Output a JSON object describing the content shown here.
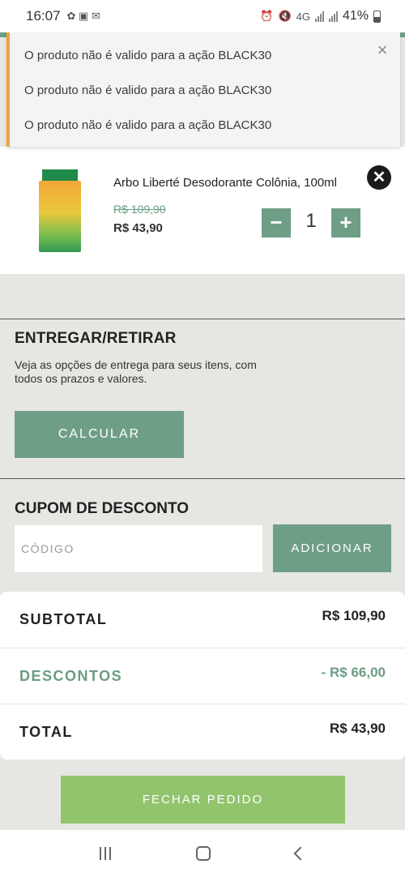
{
  "status_bar": {
    "time": "16:07",
    "network": "4G",
    "battery": "41%"
  },
  "toast": {
    "messages": [
      "O produto não é valido para a ação BLACK30",
      "O produto não é valido para a ação BLACK30",
      "O produto não é valido para a ação BLACK30"
    ],
    "close_icon": "×",
    "accent_color": "#f1a33a"
  },
  "product": {
    "name": "Arbo Liberté Desodorante Colônia, 100ml",
    "old_price": "R$ 109,90",
    "new_price": "R$ 43,90",
    "quantity": "1",
    "minus_label": "−",
    "plus_label": "+",
    "remove_icon": "✕"
  },
  "delivery": {
    "title": "ENTREGAR/RETIRAR",
    "description": "Veja as opções de entrega para seus itens, com todos os prazos e valores.",
    "button": "CALCULAR"
  },
  "coupon": {
    "title": "CUPOM DE DESCONTO",
    "placeholder": "CÓDIGO",
    "button": "ADICIONAR"
  },
  "totals": {
    "subtotal_label": "SUBTOTAL",
    "subtotal_value": "R$ 109,90",
    "discount_label": "DESCONTOS",
    "discount_value": "- R$ 66,00",
    "total_label": "TOTAL",
    "total_value": "R$ 43,90"
  },
  "checkout_button": "FECHAR PEDIDO",
  "colors": {
    "brand_green": "#6f9e86",
    "checkout_green": "#92c46d"
  }
}
